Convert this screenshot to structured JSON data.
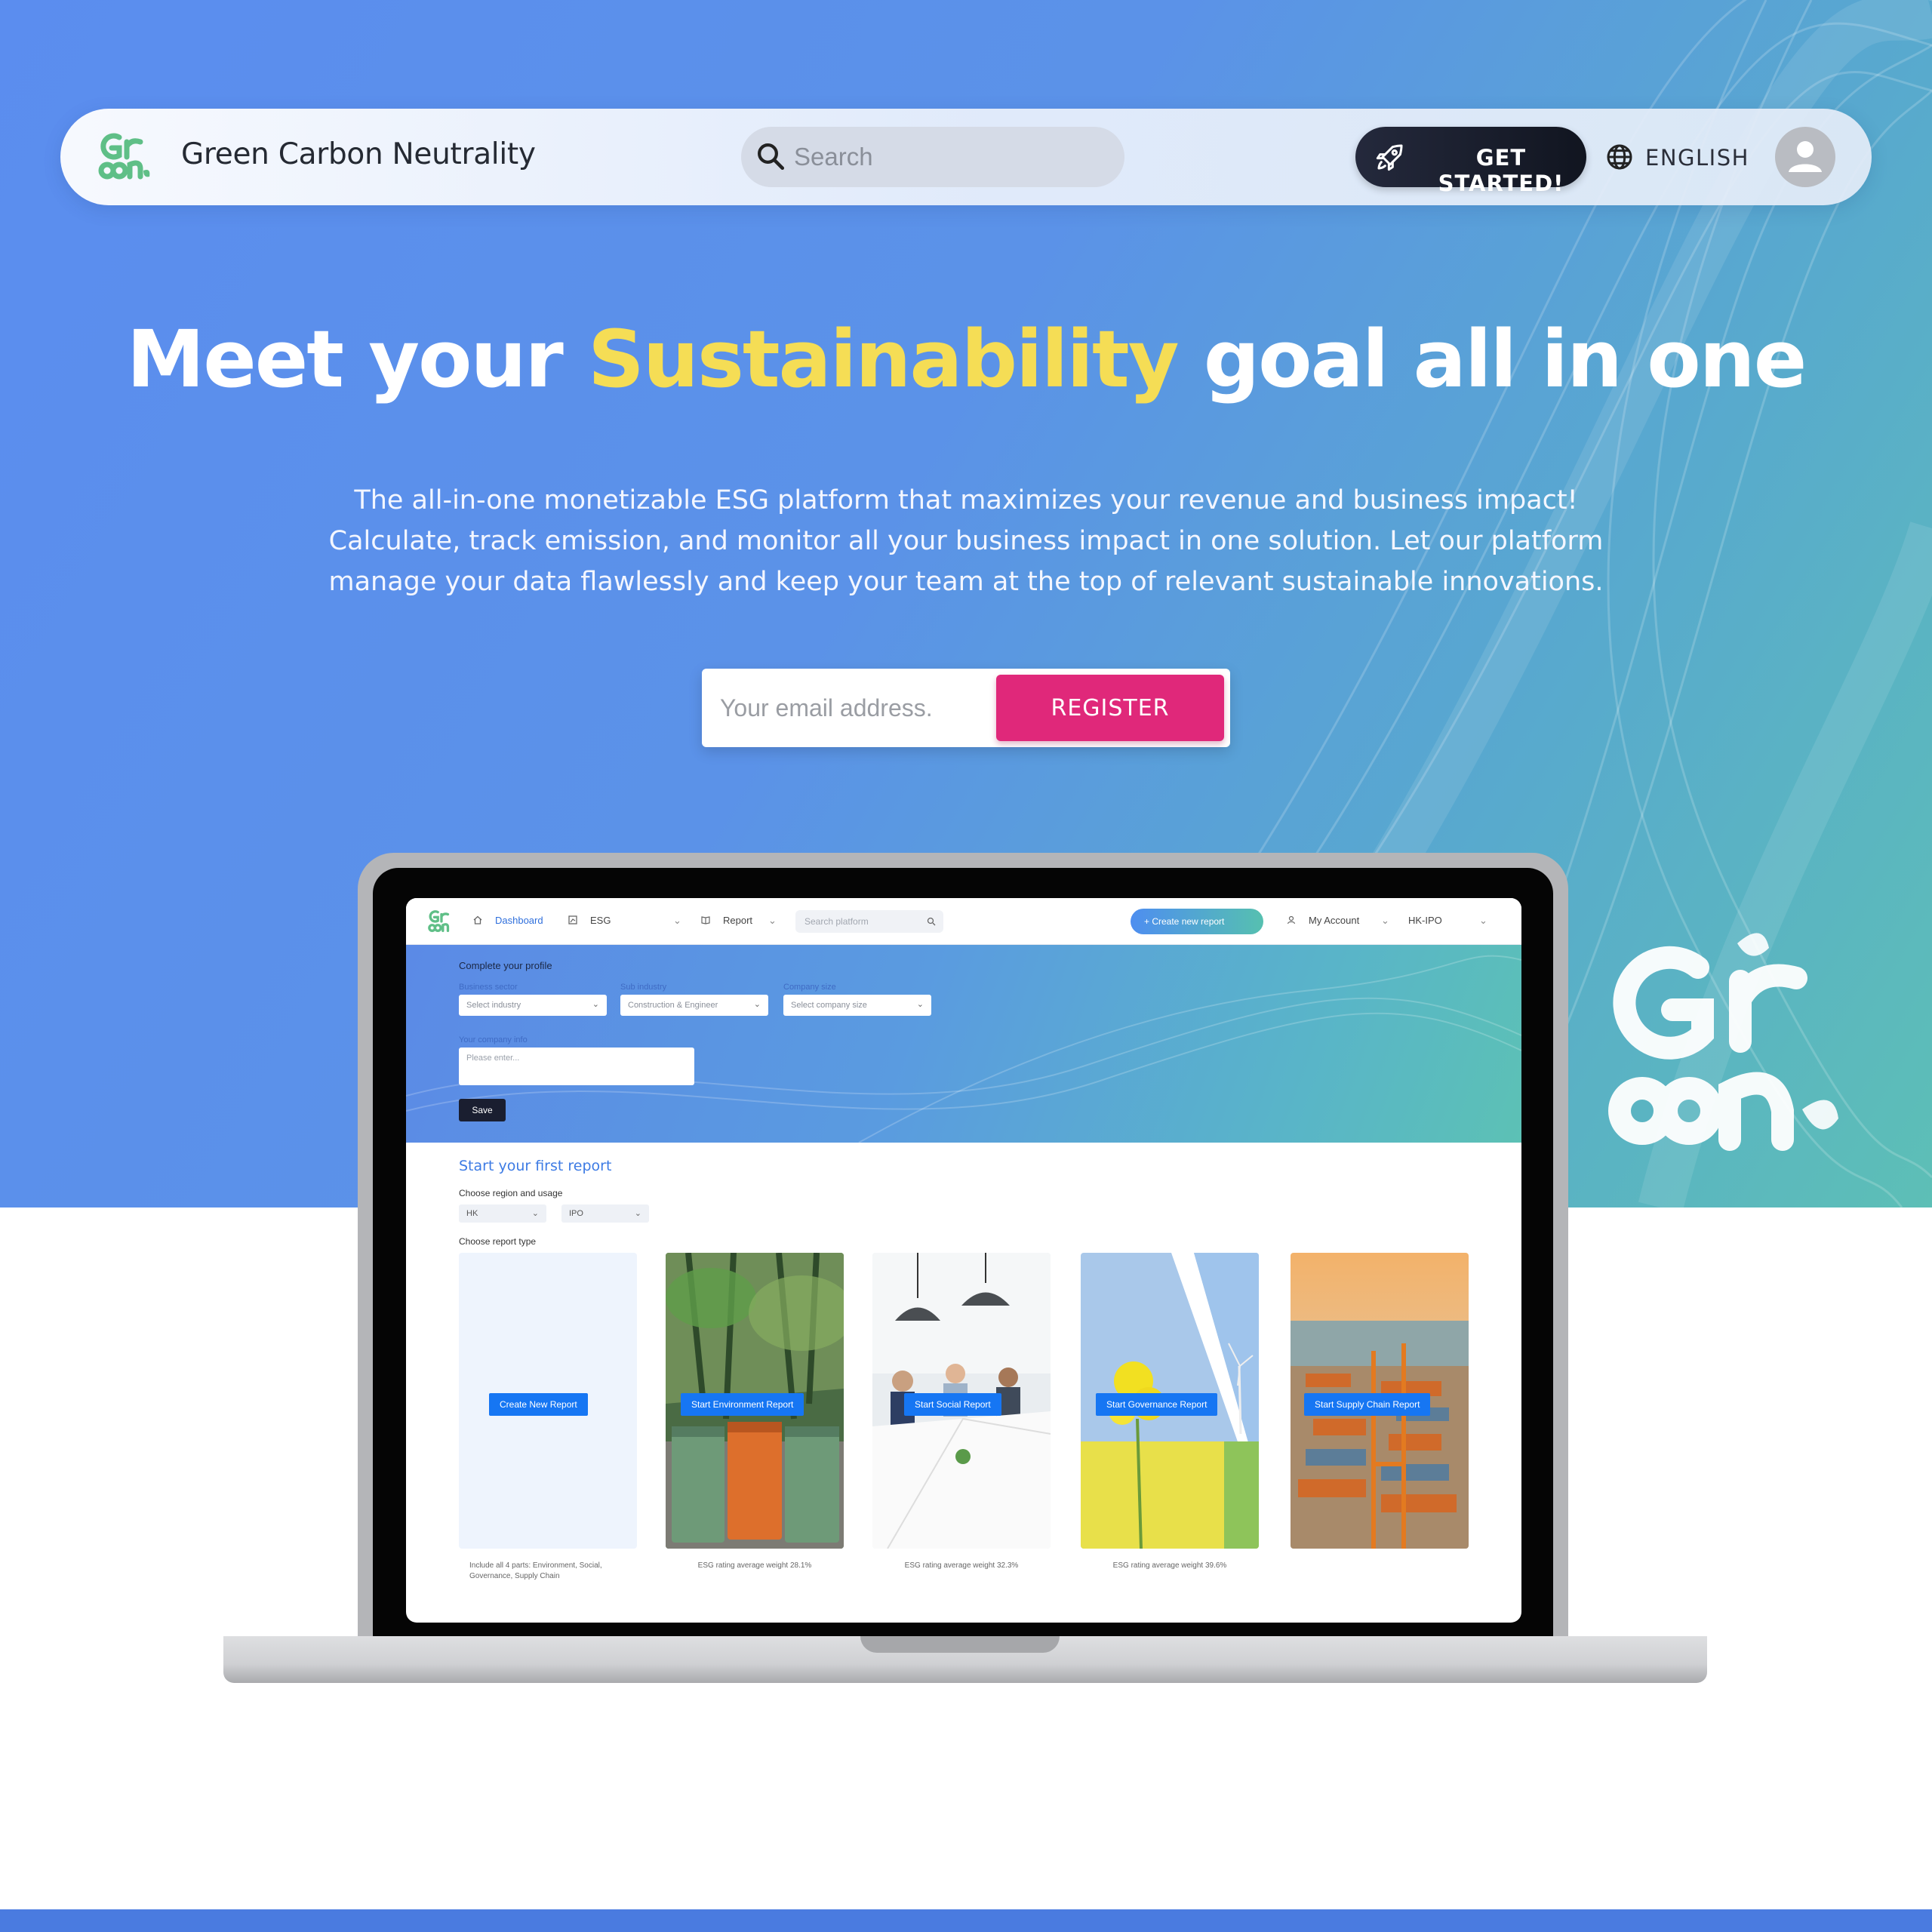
{
  "brand": {
    "name": "Green Carbon Neutrality"
  },
  "nav": {
    "search_placeholder": "Search",
    "get_started_label": "GET STARTED!",
    "language_label": "ENGLISH"
  },
  "hero": {
    "headline_before": "Meet your ",
    "headline_highlight": "Sustainability",
    "headline_after": " goal all in one",
    "description": "The all-in-one monetizable ESG platform that maximizes your revenue and business impact! Calculate, track emission, and monitor all your business impact in one solution. Let our platform manage your data flawlessly and keep your team at the top of relevant sustainable innovations.",
    "email_placeholder": "Your email address.",
    "register_label": "REGISTER"
  },
  "colors": {
    "hero_gradient_start": "#5b8def",
    "hero_gradient_end": "#5dbfb6",
    "highlight": "#f5dd55",
    "register_button": "#e0287a",
    "get_started_button": "#1a1e30"
  },
  "preview": {
    "nav": {
      "dashboard": "Dashboard",
      "esg": "ESG",
      "report": "Report",
      "search_placeholder": "Search platform",
      "create_new_report": "+ Create new report",
      "my_account": "My Account",
      "company": "HK-IPO"
    },
    "profile": {
      "title": "Complete your profile",
      "business_sector_label": "Business sector",
      "business_sector_value": "Select industry",
      "sub_industry_label": "Sub industry",
      "sub_industry_value": "Construction & Engineer",
      "company_size_label": "Company size",
      "company_size_value": "Select company size",
      "company_info_label": "Your company info",
      "company_info_placeholder": "Please enter...",
      "save_label": "Save"
    },
    "report": {
      "title": "Start your first report",
      "region_label": "Choose region and usage",
      "region_value": "HK",
      "usage_value": "IPO",
      "type_label": "Choose report type",
      "cards": [
        {
          "button": "Create New Report",
          "note": "Include all 4 parts: Environment, Social, Governance, Supply Chain"
        },
        {
          "button": "Start Environment Report",
          "note": "ESG rating average weight 28.1%"
        },
        {
          "button": "Start Social Report",
          "note": "ESG rating average weight  32.3%"
        },
        {
          "button": "Start Governance Report",
          "note": "ESG rating average weight  39.6%"
        },
        {
          "button": "Start Supply Chain Report",
          "note": ""
        }
      ]
    }
  }
}
